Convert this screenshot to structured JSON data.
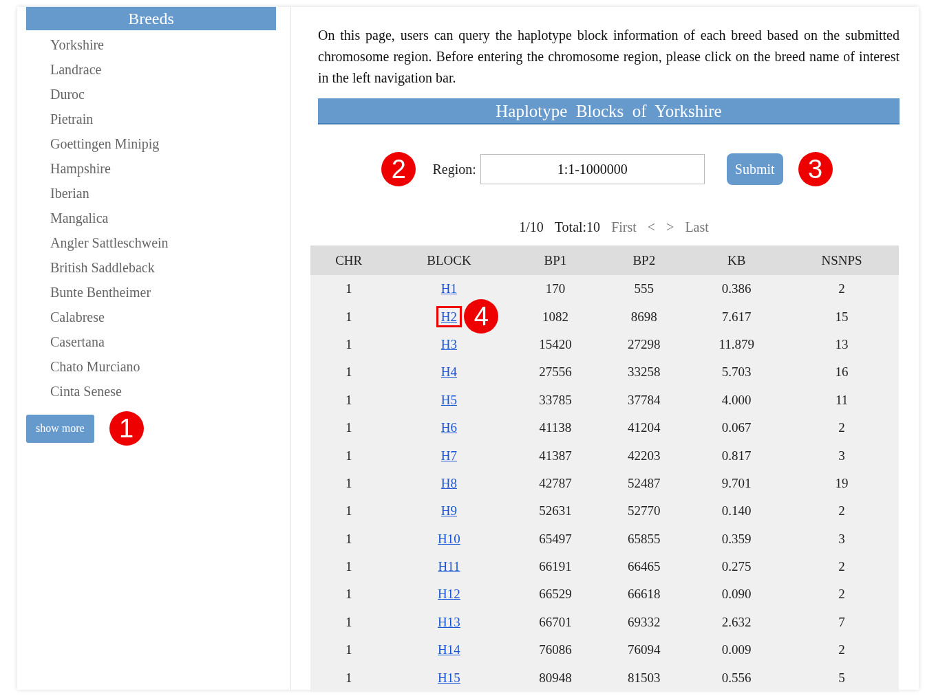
{
  "sidebar": {
    "title": "Breeds",
    "items": [
      {
        "label": "Yorkshire"
      },
      {
        "label": "Landrace"
      },
      {
        "label": "Duroc"
      },
      {
        "label": "Pietrain"
      },
      {
        "label": "Goettingen Minipig"
      },
      {
        "label": "Hampshire"
      },
      {
        "label": "Iberian"
      },
      {
        "label": "Mangalica"
      },
      {
        "label": "Angler Sattleschwein"
      },
      {
        "label": "British Saddleback"
      },
      {
        "label": "Bunte Bentheimer"
      },
      {
        "label": "Calabrese"
      },
      {
        "label": "Casertana"
      },
      {
        "label": "Chato Murciano"
      },
      {
        "label": "Cinta Senese"
      }
    ],
    "show_more": {
      "label": "show more",
      "annotation": "1"
    }
  },
  "main": {
    "intro": "On this page, users can query the haplotype block information of each breed based on the submitted chromosome region. Before entering the chromosome region, please click on the breed name of interest in the left navigation bar.",
    "title": "Haplotype  Blocks  of  Yorkshire",
    "region": {
      "annotation": "2",
      "label": "Region:",
      "value": "1:1-1000000"
    },
    "submit": {
      "label": "Submit",
      "annotation": "3"
    },
    "pagination": {
      "page": "1/10",
      "total": "Total:10",
      "first": "First",
      "prev": "<",
      "next": ">",
      "last": "Last"
    },
    "table": {
      "columns": [
        "CHR",
        "BLOCK",
        "BP1",
        "BP2",
        "KB",
        "NSNPS"
      ],
      "rows": [
        {
          "chr": "1",
          "block": "H1",
          "bp1": "170",
          "bp2": "555",
          "kb": "0.386",
          "nsnps": "2",
          "highlighted": false
        },
        {
          "chr": "1",
          "block": "H2",
          "bp1": "1082",
          "bp2": "8698",
          "kb": "7.617",
          "nsnps": "15",
          "highlighted": true,
          "annotation": "4"
        },
        {
          "chr": "1",
          "block": "H3",
          "bp1": "15420",
          "bp2": "27298",
          "kb": "11.879",
          "nsnps": "13",
          "highlighted": false
        },
        {
          "chr": "1",
          "block": "H4",
          "bp1": "27556",
          "bp2": "33258",
          "kb": "5.703",
          "nsnps": "16",
          "highlighted": false
        },
        {
          "chr": "1",
          "block": "H5",
          "bp1": "33785",
          "bp2": "37784",
          "kb": "4.000",
          "nsnps": "11",
          "highlighted": false
        },
        {
          "chr": "1",
          "block": "H6",
          "bp1": "41138",
          "bp2": "41204",
          "kb": "0.067",
          "nsnps": "2",
          "highlighted": false
        },
        {
          "chr": "1",
          "block": "H7",
          "bp1": "41387",
          "bp2": "42203",
          "kb": "0.817",
          "nsnps": "3",
          "highlighted": false
        },
        {
          "chr": "1",
          "block": "H8",
          "bp1": "42787",
          "bp2": "52487",
          "kb": "9.701",
          "nsnps": "19",
          "highlighted": false
        },
        {
          "chr": "1",
          "block": "H9",
          "bp1": "52631",
          "bp2": "52770",
          "kb": "0.140",
          "nsnps": "2",
          "highlighted": false
        },
        {
          "chr": "1",
          "block": "H10",
          "bp1": "65497",
          "bp2": "65855",
          "kb": "0.359",
          "nsnps": "3",
          "highlighted": false
        },
        {
          "chr": "1",
          "block": "H11",
          "bp1": "66191",
          "bp2": "66465",
          "kb": "0.275",
          "nsnps": "2",
          "highlighted": false
        },
        {
          "chr": "1",
          "block": "H12",
          "bp1": "66529",
          "bp2": "66618",
          "kb": "0.090",
          "nsnps": "2",
          "highlighted": false
        },
        {
          "chr": "1",
          "block": "H13",
          "bp1": "66701",
          "bp2": "69332",
          "kb": "2.632",
          "nsnps": "7",
          "highlighted": false
        },
        {
          "chr": "1",
          "block": "H14",
          "bp1": "76086",
          "bp2": "76094",
          "kb": "0.009",
          "nsnps": "2",
          "highlighted": false
        },
        {
          "chr": "1",
          "block": "H15",
          "bp1": "80948",
          "bp2": "81503",
          "kb": "0.556",
          "nsnps": "5",
          "highlighted": false
        }
      ]
    }
  }
}
